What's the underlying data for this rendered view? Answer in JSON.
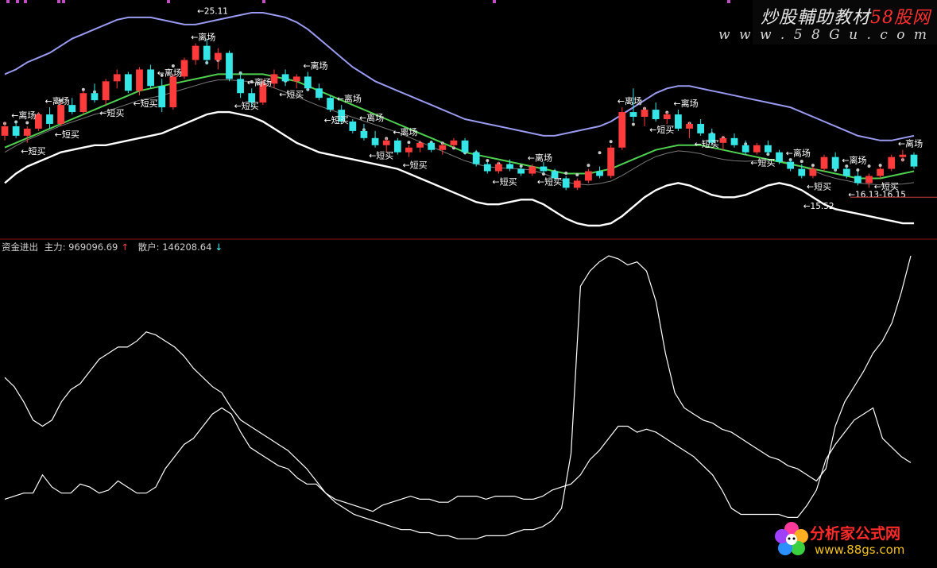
{
  "watermark": {
    "title_a": "炒股輔助教材",
    "title_b": "58股网",
    "url": "w w w . 5 8 G u . c o m"
  },
  "indicator": {
    "name": "资金进出",
    "main_label": "主力: 969096.69",
    "retail_label": "散户: 146208.64",
    "up_arrow": "↑",
    "down_arrow": "↓"
  },
  "logo": {
    "text": "分析家公式网",
    "url": "www.88gs.com"
  },
  "colors": {
    "up_candle": "#ff3b3b",
    "down_candle": "#35e6e6",
    "upper_band": "#9a9af0",
    "lower_band": "#ffffff",
    "mid_line": "#50d050",
    "signal_dots": "#c8c8c8",
    "label_text": "#ffffff",
    "panel_divider": "#8a1010"
  },
  "chart_data": [
    {
      "type": "candlestick",
      "candles": [
        [
          2.0,
          2.6,
          1.8,
          2.4
        ],
        [
          2.4,
          2.6,
          1.9,
          2.0
        ],
        [
          2.0,
          2.4,
          1.7,
          2.3
        ],
        [
          2.3,
          3.0,
          2.2,
          2.9
        ],
        [
          2.9,
          3.2,
          2.3,
          2.5
        ],
        [
          2.5,
          3.4,
          2.4,
          3.3
        ],
        [
          3.3,
          3.6,
          2.9,
          3.0
        ],
        [
          3.0,
          3.9,
          2.9,
          3.8
        ],
        [
          3.8,
          4.2,
          3.4,
          3.5
        ],
        [
          3.5,
          4.4,
          3.3,
          4.3
        ],
        [
          4.3,
          4.8,
          4.0,
          4.6
        ],
        [
          4.6,
          4.7,
          3.8,
          3.9
        ],
        [
          3.9,
          4.9,
          3.7,
          4.8
        ],
        [
          4.8,
          5.0,
          4.0,
          4.1
        ],
        [
          4.1,
          4.4,
          3.0,
          3.2
        ],
        [
          3.2,
          4.6,
          3.1,
          4.5
        ],
        [
          4.5,
          5.3,
          4.4,
          5.2
        ],
        [
          5.2,
          5.9,
          5.0,
          5.8
        ],
        [
          5.8,
          6.1,
          5.0,
          5.2
        ],
        [
          5.2,
          5.7,
          4.8,
          5.5
        ],
        [
          5.5,
          5.6,
          4.3,
          4.4
        ],
        [
          4.4,
          4.7,
          3.6,
          3.8
        ],
        [
          3.8,
          4.0,
          3.2,
          3.4
        ],
        [
          3.4,
          4.4,
          3.3,
          4.2
        ],
        [
          4.2,
          4.8,
          4.0,
          4.6
        ],
        [
          4.6,
          4.8,
          4.1,
          4.3
        ],
        [
          4.3,
          4.6,
          4.0,
          4.5
        ],
        [
          4.5,
          4.7,
          3.9,
          4.0
        ],
        [
          4.0,
          4.2,
          3.5,
          3.6
        ],
        [
          3.6,
          3.7,
          3.0,
          3.1
        ],
        [
          3.1,
          3.3,
          2.5,
          2.6
        ],
        [
          2.6,
          2.7,
          2.1,
          2.2
        ],
        [
          2.2,
          2.5,
          1.8,
          1.9
        ],
        [
          1.9,
          2.2,
          1.5,
          1.6
        ],
        [
          1.6,
          1.9,
          1.3,
          1.8
        ],
        [
          1.8,
          1.9,
          1.2,
          1.3
        ],
        [
          1.3,
          1.6,
          1.1,
          1.5
        ],
        [
          1.5,
          1.8,
          1.3,
          1.7
        ],
        [
          1.7,
          1.8,
          1.3,
          1.4
        ],
        [
          1.4,
          1.7,
          1.2,
          1.6
        ],
        [
          1.6,
          1.9,
          1.5,
          1.8
        ],
        [
          1.8,
          1.9,
          1.2,
          1.3
        ],
        [
          1.3,
          1.4,
          0.7,
          0.8
        ],
        [
          0.8,
          0.9,
          0.4,
          0.5
        ],
        [
          0.5,
          0.9,
          0.4,
          0.8
        ],
        [
          0.8,
          1.0,
          0.5,
          0.6
        ],
        [
          0.6,
          0.7,
          0.3,
          0.4
        ],
        [
          0.4,
          0.8,
          0.3,
          0.7
        ],
        [
          0.7,
          0.9,
          0.4,
          0.5
        ],
        [
          0.5,
          0.6,
          0.1,
          0.2
        ],
        [
          0.2,
          0.3,
          -0.3,
          -0.2
        ],
        [
          -0.2,
          0.2,
          -0.3,
          0.1
        ],
        [
          0.1,
          0.6,
          0.0,
          0.5
        ],
        [
          0.5,
          0.7,
          0.2,
          0.3
        ],
        [
          0.3,
          1.6,
          0.2,
          1.5
        ],
        [
          1.5,
          3.2,
          1.4,
          3.0
        ],
        [
          3.0,
          4.0,
          2.6,
          2.8
        ],
        [
          2.8,
          3.2,
          2.4,
          3.1
        ],
        [
          3.1,
          3.4,
          2.6,
          2.7
        ],
        [
          2.7,
          3.0,
          2.5,
          2.9
        ],
        [
          2.9,
          3.1,
          2.2,
          2.3
        ],
        [
          2.3,
          2.6,
          1.9,
          2.5
        ],
        [
          2.5,
          2.7,
          2.0,
          2.1
        ],
        [
          2.1,
          2.3,
          1.6,
          1.7
        ],
        [
          1.7,
          2.0,
          1.4,
          1.9
        ],
        [
          1.9,
          2.1,
          1.5,
          1.6
        ],
        [
          1.6,
          1.8,
          1.2,
          1.3
        ],
        [
          1.3,
          1.7,
          1.2,
          1.6
        ],
        [
          1.6,
          1.8,
          1.2,
          1.3
        ],
        [
          1.3,
          1.4,
          0.8,
          0.9
        ],
        [
          0.9,
          1.0,
          0.5,
          0.6
        ],
        [
          0.6,
          0.8,
          0.2,
          0.3
        ],
        [
          0.3,
          0.7,
          0.2,
          0.6
        ],
        [
          0.6,
          1.2,
          0.5,
          1.1
        ],
        [
          1.1,
          1.3,
          0.5,
          0.6
        ],
        [
          0.6,
          0.7,
          0.2,
          0.3
        ],
        [
          0.3,
          0.5,
          -0.1,
          0.0
        ],
        [
          0.0,
          0.4,
          -0.2,
          0.3
        ],
        [
          0.3,
          0.7,
          0.2,
          0.6
        ],
        [
          0.6,
          1.2,
          0.5,
          1.1
        ],
        [
          1.1,
          1.4,
          0.9,
          1.2
        ],
        [
          1.2,
          1.3,
          0.6,
          0.7
        ]
      ],
      "upper_band": [
        4.6,
        4.8,
        5.1,
        5.3,
        5.5,
        5.8,
        6.1,
        6.3,
        6.5,
        6.7,
        6.9,
        7.0,
        7.0,
        7.0,
        6.9,
        6.8,
        6.7,
        6.7,
        6.8,
        6.9,
        7.0,
        7.1,
        7.2,
        7.2,
        7.1,
        7.0,
        6.8,
        6.5,
        6.1,
        5.7,
        5.3,
        4.9,
        4.6,
        4.3,
        4.1,
        3.9,
        3.7,
        3.5,
        3.3,
        3.1,
        2.9,
        2.7,
        2.6,
        2.5,
        2.4,
        2.3,
        2.2,
        2.1,
        2.0,
        2.0,
        2.1,
        2.2,
        2.3,
        2.4,
        2.6,
        2.9,
        3.2,
        3.5,
        3.8,
        4.0,
        4.1,
        4.1,
        4.0,
        3.9,
        3.8,
        3.7,
        3.6,
        3.5,
        3.4,
        3.3,
        3.2,
        3.0,
        2.8,
        2.6,
        2.4,
        2.2,
        2.0,
        1.9,
        1.8,
        1.8,
        1.9,
        2.0
      ],
      "lower_band": [
        0.0,
        0.4,
        0.7,
        0.9,
        1.1,
        1.3,
        1.4,
        1.5,
        1.6,
        1.6,
        1.7,
        1.8,
        1.9,
        2.0,
        2.1,
        2.3,
        2.5,
        2.7,
        2.9,
        3.0,
        3.0,
        2.9,
        2.8,
        2.6,
        2.3,
        2.0,
        1.7,
        1.5,
        1.3,
        1.2,
        1.1,
        1.0,
        0.9,
        0.8,
        0.7,
        0.6,
        0.4,
        0.2,
        0.0,
        -0.2,
        -0.4,
        -0.6,
        -0.8,
        -0.9,
        -0.9,
        -0.8,
        -0.7,
        -0.7,
        -0.9,
        -1.2,
        -1.5,
        -1.7,
        -1.8,
        -1.8,
        -1.7,
        -1.4,
        -1.0,
        -0.6,
        -0.3,
        -0.1,
        0.0,
        -0.1,
        -0.3,
        -0.5,
        -0.6,
        -0.6,
        -0.5,
        -0.3,
        -0.1,
        0.0,
        -0.1,
        -0.3,
        -0.6,
        -0.9,
        -1.1,
        -1.2,
        -1.3,
        -1.4,
        -1.5,
        -1.6,
        -1.7,
        -1.7
      ],
      "mid_line": [
        1.5,
        1.7,
        1.9,
        2.1,
        2.3,
        2.5,
        2.7,
        2.9,
        3.1,
        3.3,
        3.5,
        3.7,
        3.9,
        4.0,
        4.1,
        4.2,
        4.3,
        4.4,
        4.5,
        4.6,
        4.6,
        4.6,
        4.6,
        4.6,
        4.5,
        4.4,
        4.3,
        4.1,
        3.9,
        3.7,
        3.5,
        3.3,
        3.1,
        2.9,
        2.7,
        2.5,
        2.3,
        2.1,
        1.9,
        1.7,
        1.5,
        1.3,
        1.2,
        1.1,
        1.0,
        0.9,
        0.8,
        0.7,
        0.6,
        0.5,
        0.4,
        0.4,
        0.4,
        0.5,
        0.6,
        0.8,
        1.0,
        1.2,
        1.4,
        1.5,
        1.6,
        1.6,
        1.6,
        1.5,
        1.4,
        1.3,
        1.2,
        1.1,
        1.0,
        0.9,
        0.8,
        0.7,
        0.6,
        0.5,
        0.4,
        0.3,
        0.2,
        0.2,
        0.2,
        0.3,
        0.4,
        0.5
      ],
      "labels_up": [
        "离场",
        "离场",
        "离场",
        "离场",
        "离场",
        "离场",
        "离场",
        "离场",
        "离场",
        "离场",
        "离场",
        "离场",
        "离场",
        "离场",
        "离场"
      ],
      "labels_down": [
        "短买",
        "短买",
        "短买",
        "短买",
        "短买",
        "短买",
        "短买",
        "短买",
        "短买",
        "短买",
        "短买",
        "短买",
        "短买",
        "短买",
        "短买",
        "短买"
      ],
      "annotations": [
        "25.11",
        "16.13-16.15",
        "15.52"
      ]
    },
    {
      "type": "line",
      "title": "资金进出",
      "series": [
        {
          "name": "主力",
          "values": [
            60,
            57,
            52,
            46,
            44,
            46,
            52,
            56,
            58,
            62,
            66,
            68,
            70,
            70,
            72,
            75,
            74,
            72,
            70,
            67,
            63,
            60,
            57,
            55,
            50,
            46,
            44,
            42,
            40,
            38,
            36,
            33,
            30,
            26,
            22,
            19,
            17,
            15,
            14,
            13,
            12,
            11,
            10,
            10,
            9,
            9,
            8,
            8,
            7,
            7,
            7,
            8,
            8,
            8,
            9,
            10,
            10,
            11,
            13,
            17,
            35,
            90,
            95,
            98,
            100,
            99,
            97,
            98,
            95,
            85,
            68,
            55,
            50,
            48,
            46,
            45,
            43,
            42,
            40,
            38,
            36,
            34,
            33,
            31,
            30,
            28,
            26,
            30,
            44,
            52,
            57,
            62,
            68,
            72,
            78,
            88,
            100
          ]
        },
        {
          "name": "散户",
          "values": [
            20,
            21,
            22,
            22,
            28,
            24,
            22,
            22,
            25,
            24,
            22,
            23,
            26,
            24,
            22,
            22,
            24,
            30,
            34,
            38,
            40,
            44,
            48,
            50,
            48,
            42,
            37,
            35,
            33,
            31,
            30,
            27,
            25,
            25,
            22,
            20,
            19,
            18,
            17,
            16,
            18,
            19,
            20,
            21,
            20,
            20,
            19,
            19,
            21,
            21,
            21,
            20,
            21,
            21,
            21,
            20,
            20,
            21,
            23,
            24,
            25,
            28,
            33,
            36,
            40,
            44,
            44,
            42,
            43,
            42,
            40,
            38,
            36,
            34,
            31,
            28,
            23,
            17,
            15,
            15,
            15,
            15,
            15,
            14,
            14,
            18,
            23,
            33,
            38,
            42,
            46,
            48,
            50,
            40,
            37,
            34,
            32
          ]
        }
      ]
    }
  ]
}
